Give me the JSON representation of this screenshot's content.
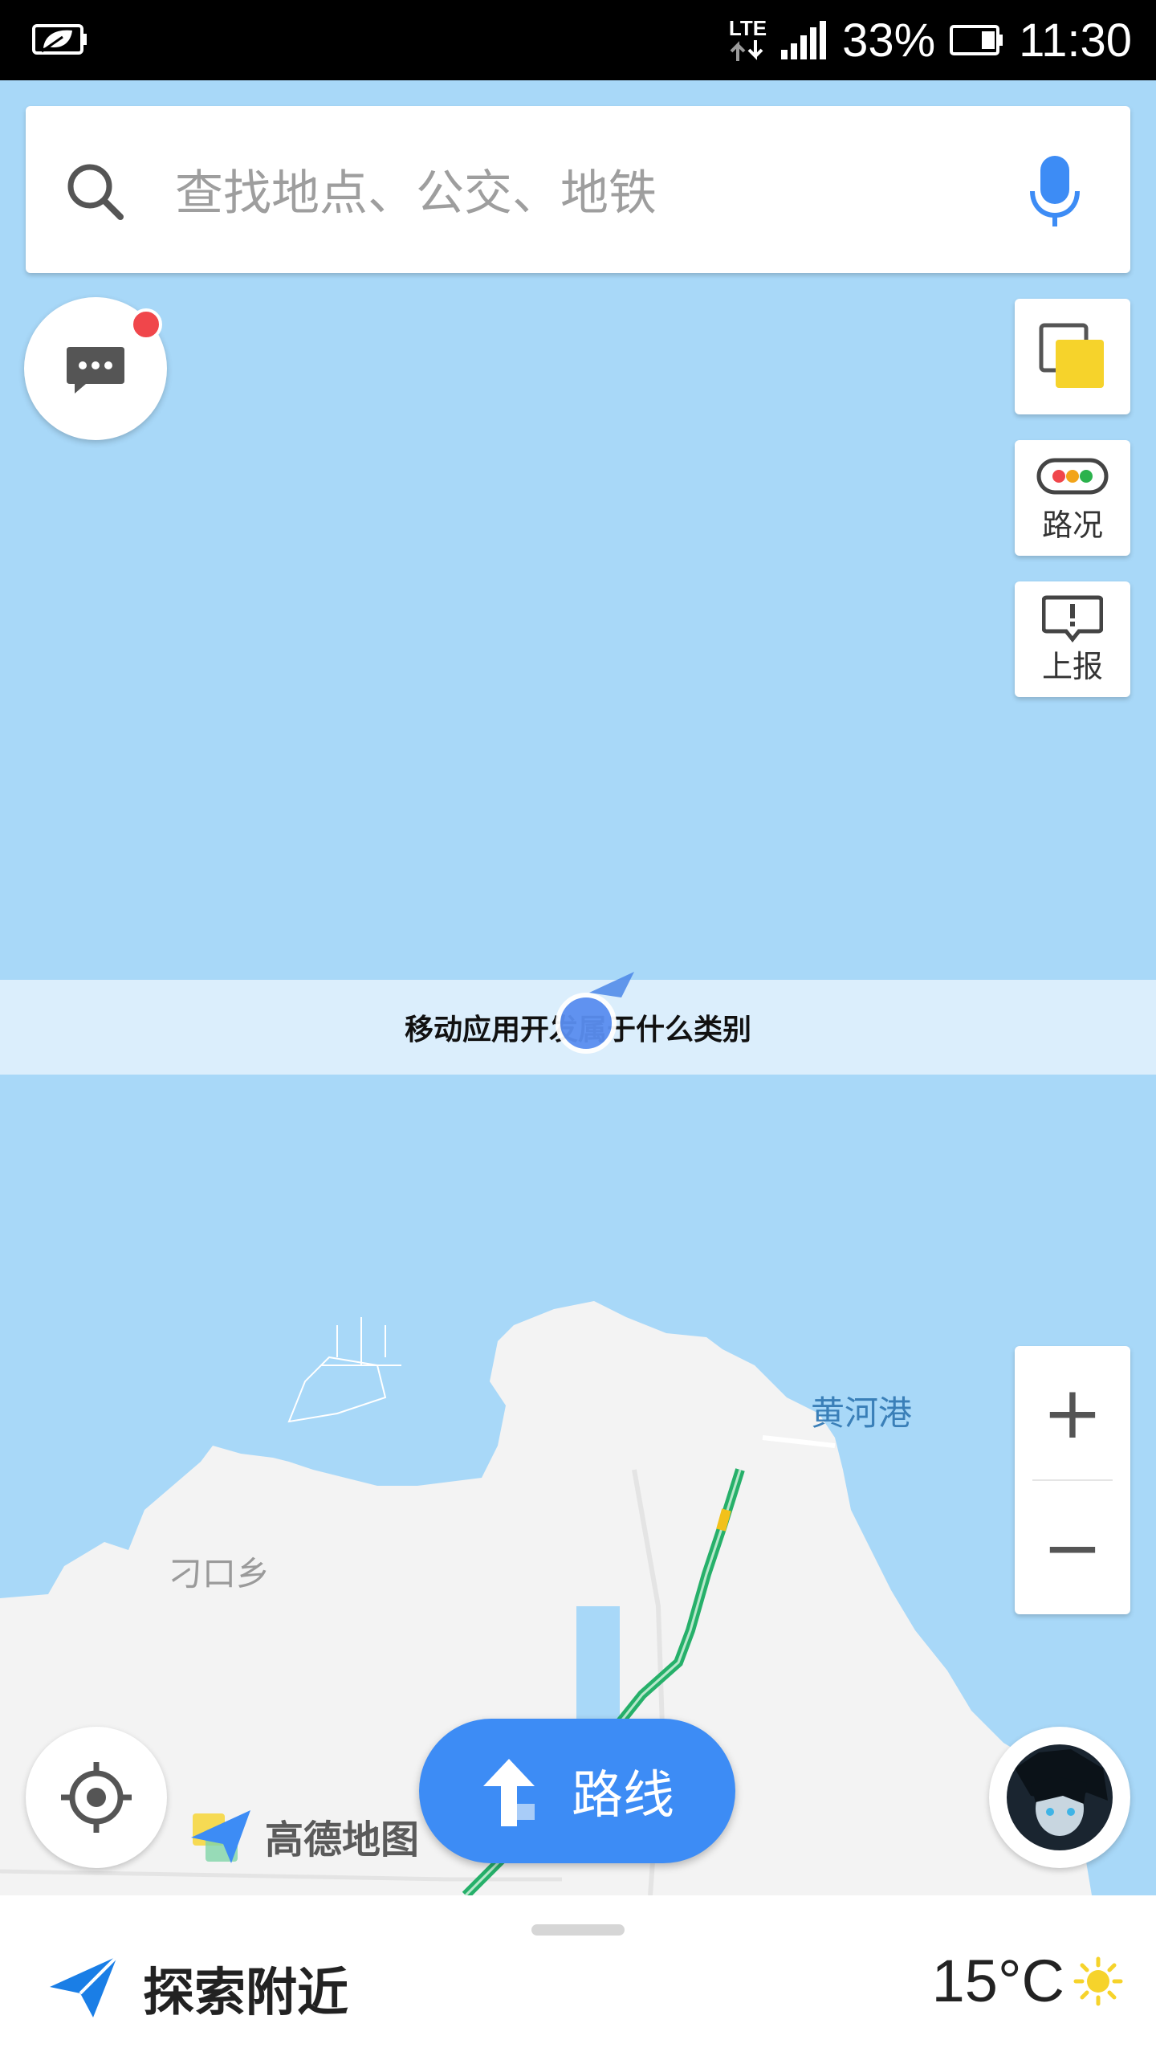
{
  "status_bar": {
    "network_type": "LTE",
    "battery_percent": "33%",
    "time": "11:30"
  },
  "search": {
    "placeholder": "查找地点、公交、地铁"
  },
  "side_buttons": {
    "layers_label": "",
    "traffic_label": "路况",
    "report_label": "上报"
  },
  "banner": {
    "text": "移动应用开发属于什么类别"
  },
  "map_labels": {
    "harbor": "黄河港",
    "township": "刁口乡"
  },
  "zoom": {
    "in_label": "+",
    "out_label": "−"
  },
  "route_button": {
    "label": "路线"
  },
  "logo": {
    "text": "高德地图"
  },
  "bottom_bar": {
    "explore_label": "探索附近",
    "temperature": "15°C"
  },
  "colors": {
    "water": "#a8d8f8",
    "land": "#f3f3f3",
    "accent": "#3d8cf5",
    "road": "#26b06a",
    "notification": "#f0464b"
  }
}
